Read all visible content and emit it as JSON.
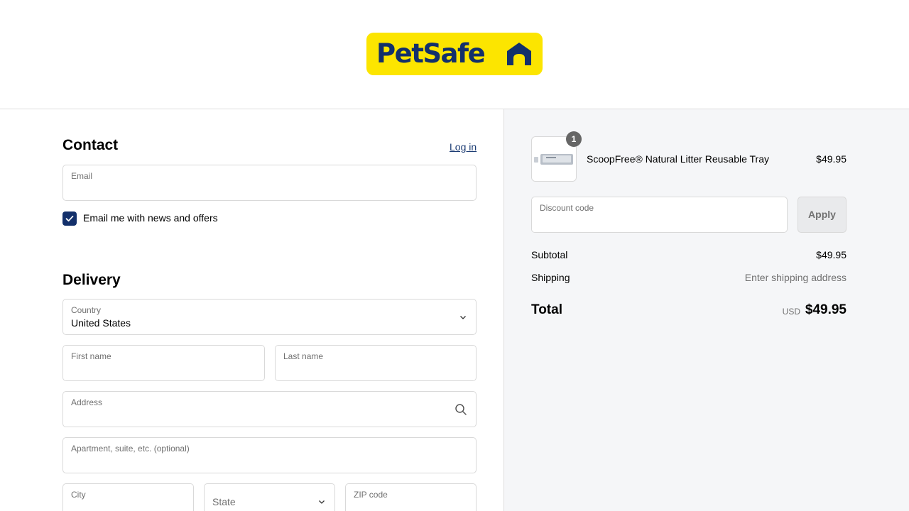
{
  "brand": {
    "logo_text": "PetSafe",
    "logo_bg": "#fce500",
    "logo_fg": "#13306b"
  },
  "contact": {
    "heading": "Contact",
    "login_link": "Log in",
    "email_label": "Email",
    "email_value": "",
    "newsletter_label": "Email me with news and offers",
    "newsletter_checked": true
  },
  "delivery": {
    "heading": "Delivery",
    "country_label": "Country",
    "country_value": "United States",
    "first_name_label": "First name",
    "last_name_label": "Last name",
    "address_label": "Address",
    "apartment_label": "Apartment, suite, etc. (optional)",
    "city_label": "City",
    "state_placeholder": "State",
    "zip_label": "ZIP code"
  },
  "summary": {
    "item": {
      "quantity": "1",
      "name": "ScoopFree® Natural Litter Reusable Tray",
      "price": "$49.95"
    },
    "discount_label": "Discount code",
    "apply_label": "Apply",
    "subtotal_label": "Subtotal",
    "subtotal_value": "$49.95",
    "shipping_label": "Shipping",
    "shipping_value": "Enter shipping address",
    "total_label": "Total",
    "total_currency": "USD",
    "total_value": "$49.95"
  },
  "icons": {
    "country_chevron": "chevron-down-icon",
    "address_search": "search-icon",
    "state_chevron": "chevron-down-icon",
    "checkbox_check": "check-icon",
    "logo_house": "house-icon"
  }
}
